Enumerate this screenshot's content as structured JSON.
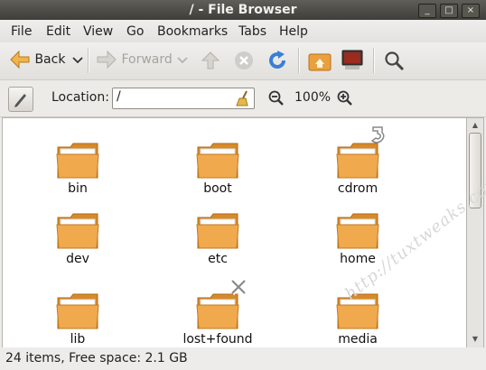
{
  "window": {
    "title": "/ - File Browser",
    "buttons": [
      "_",
      "□",
      "×"
    ]
  },
  "menu": [
    {
      "label": "File"
    },
    {
      "label": "Edit"
    },
    {
      "label": "View"
    },
    {
      "label": "Go"
    },
    {
      "label": "Bookmarks"
    },
    {
      "label": "Tabs"
    },
    {
      "label": "Help"
    }
  ],
  "toolbar": {
    "back_label": "Back",
    "forward_label": "Forward",
    "colors": {
      "back_arrow": "#e8a63a",
      "reload": "#3a7fd6",
      "home": "#e07a1a"
    }
  },
  "location": {
    "label": "Location:",
    "value": "/",
    "zoom": "100%"
  },
  "folders": [
    {
      "name": "bin"
    },
    {
      "name": "boot"
    },
    {
      "name": "cdrom"
    },
    {
      "name": "dev"
    },
    {
      "name": "etc"
    },
    {
      "name": "home"
    },
    {
      "name": "lib"
    },
    {
      "name": "lost+found"
    },
    {
      "name": "media"
    }
  ],
  "status": {
    "text": "24 items, Free space: 2.1 GB"
  },
  "watermark": "http://tuxtweaks.com/"
}
